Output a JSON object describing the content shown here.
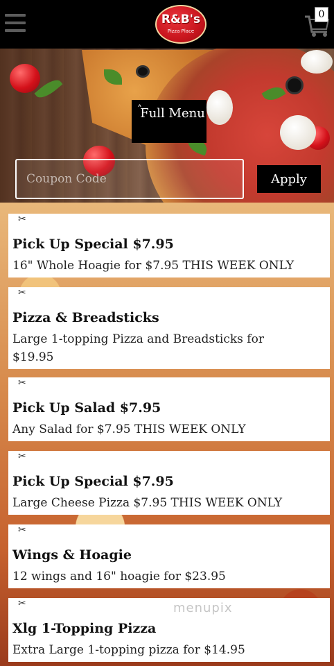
{
  "header": {
    "logo_title": "R&B's",
    "logo_subtitle": "Pizza Place",
    "cart_count": "0",
    "menu_icon": "hamburger-icon",
    "cart_icon": "shopping-cart-icon"
  },
  "hero": {
    "full_menu_label": "Full Menu",
    "caret": "˄",
    "coupon_placeholder": "Coupon Code",
    "apply_label": "Apply"
  },
  "deals": [
    {
      "icon": "scissors-icon",
      "title": "Pick Up Special $7.95",
      "description": "16\" Whole Hoagie for $7.95 THIS WEEK ONLY"
    },
    {
      "icon": "scissors-icon",
      "title": "Pizza & Breadsticks",
      "description": "Large 1-topping Pizza and Breadsticks for $19.95"
    },
    {
      "icon": "scissors-icon",
      "title": "Pick Up Salad $7.95",
      "description": "Any Salad for $7.95 THIS WEEK ONLY"
    },
    {
      "icon": "scissors-icon",
      "title": "Pick Up Special $7.95",
      "description": "Large Cheese Pizza $7.95 THIS WEEK ONLY"
    },
    {
      "icon": "scissors-icon",
      "title": "Wings & Hoagie",
      "description": "12 wings and 16\" hoagie for $23.95"
    },
    {
      "icon": "scissors-icon",
      "title": "Xlg 1-Topping Pizza",
      "description": "Extra Large 1-topping pizza for $14.95"
    }
  ],
  "watermark": "menupix",
  "colors": {
    "topbar": "#000000",
    "logo_red": "#c8151d",
    "card": "#ffffff"
  }
}
